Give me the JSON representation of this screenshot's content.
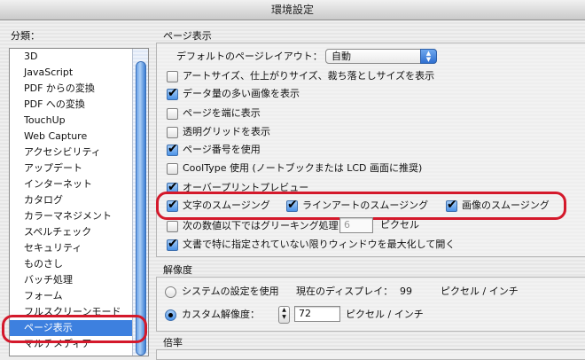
{
  "window": {
    "title": "環境設定"
  },
  "sidebar": {
    "label": "分類：",
    "items": [
      "3D",
      "JavaScript",
      "PDF からの変換",
      "PDF への変換",
      "TouchUp",
      "Web Capture",
      "アクセシビリティ",
      "アップデート",
      "インターネット",
      "カタログ",
      "カラーマネジメント",
      "スペルチェック",
      "セキュリティ",
      "ものさし",
      "バッチ処理",
      "フォーム",
      "フルスクリーンモード",
      "ページ表示",
      "マルチメディア"
    ],
    "selected": "ページ表示"
  },
  "page_display": {
    "section_title": "ページ表示",
    "default_layout_label": "デフォルトのページレイアウト：",
    "default_layout_value": "自動",
    "options": [
      {
        "label": "アートサイズ、仕上がりサイズ、裁ち落としサイズを表示",
        "checked": false
      },
      {
        "label": "データ量の多い画像を表示",
        "checked": true
      },
      {
        "label": "ページを端に表示",
        "checked": false
      },
      {
        "label": "透明グリッドを表示",
        "checked": false
      },
      {
        "label": "ページ番号を使用",
        "checked": true
      },
      {
        "label": "CoolType 使用 (ノートブックまたは LCD 画面に推奨)",
        "checked": false
      },
      {
        "label": "オーバープリントプレビュー",
        "checked": true
      }
    ],
    "smoothing": [
      {
        "label": "文字のスムージング",
        "checked": true
      },
      {
        "label": "ラインアートのスムージング",
        "checked": true
      },
      {
        "label": "画像のスムージング",
        "checked": true
      }
    ],
    "greeking": {
      "label": "次の数値以下ではグリーキング処理：",
      "value": "6",
      "unit": "ピクセル",
      "checked": false
    },
    "maximize": {
      "label": "文書で特に指定されていない限りウィンドウを最大化して開く",
      "checked": true
    }
  },
  "resolution": {
    "section_title": "解像度",
    "system_label": "システムの設定を使用",
    "current_display_label": "現在のディスプレイ：",
    "current_display_value": "99",
    "current_display_unit": "ピクセル / インチ",
    "custom_label": "カスタム解像度：",
    "custom_value": "72",
    "custom_unit": "ピクセル / インチ",
    "selected": "custom"
  },
  "magnification": {
    "section_title": "倍率"
  },
  "colors": {
    "selection": "#3d80df",
    "highlight_ring": "#d4192b",
    "aqua_blue": "#4c93e8"
  }
}
